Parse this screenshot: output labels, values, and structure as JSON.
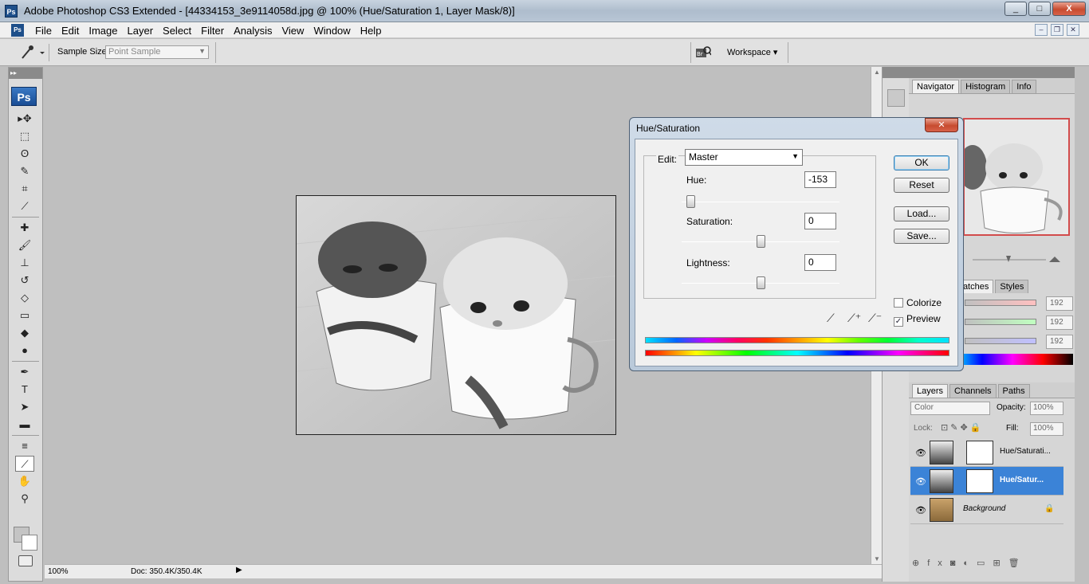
{
  "app": {
    "title": "Adobe Photoshop CS3 Extended - [44334153_3e9114058d.jpg @ 100% (Hue/Saturation 1, Layer Mask/8)]",
    "window_buttons": [
      "_",
      "□",
      "X"
    ]
  },
  "menu": {
    "items": [
      "File",
      "Edit",
      "Image",
      "Layer",
      "Select",
      "Filter",
      "Analysis",
      "View",
      "Window",
      "Help"
    ]
  },
  "options": {
    "sample_size_label": "Sample Size:",
    "sample_size_value": "Point Sample",
    "workspace_label": "Workspace ▾"
  },
  "toolbox": {
    "logo": "Ps",
    "tools": [
      {
        "name": "move-tool",
        "glyph": "▸✥"
      },
      {
        "name": "marquee-tool",
        "glyph": "⬚"
      },
      {
        "name": "lasso-tool",
        "glyph": "ʘ"
      },
      {
        "name": "quick-selection-tool",
        "glyph": "✎"
      },
      {
        "name": "crop-tool",
        "glyph": "⌗"
      },
      {
        "name": "slice-tool",
        "glyph": "⟋"
      },
      {
        "name": "healing-brush-tool",
        "glyph": "✚"
      },
      {
        "name": "brush-tool",
        "glyph": "🖌"
      },
      {
        "name": "clone-stamp-tool",
        "glyph": "⊥"
      },
      {
        "name": "history-brush-tool",
        "glyph": "↺"
      },
      {
        "name": "eraser-tool",
        "glyph": "◇"
      },
      {
        "name": "gradient-tool",
        "glyph": "▭"
      },
      {
        "name": "blur-tool",
        "glyph": "◆"
      },
      {
        "name": "dodge-tool",
        "glyph": "●"
      },
      {
        "name": "pen-tool",
        "glyph": "✒"
      },
      {
        "name": "type-tool",
        "glyph": "T"
      },
      {
        "name": "path-selection-tool",
        "glyph": "➤"
      },
      {
        "name": "rectangle-tool",
        "glyph": "▬"
      },
      {
        "name": "notes-tool",
        "glyph": "≡"
      },
      {
        "name": "eyedropper-tool",
        "glyph": "⟋"
      },
      {
        "name": "hand-tool",
        "glyph": "✋"
      },
      {
        "name": "zoom-tool",
        "glyph": "⚲"
      }
    ]
  },
  "status": {
    "zoom": "100%",
    "doc": "Doc: 350.4K/350.4K"
  },
  "navigator": {
    "tabs": [
      "Navigator",
      "Histogram",
      "Info"
    ]
  },
  "color": {
    "tabs": [
      "watches",
      "Styles"
    ],
    "values": [
      "192",
      "192",
      "192"
    ]
  },
  "layers": {
    "tabs": [
      "Layers",
      "Channels",
      "Paths"
    ],
    "blend_mode": "Color",
    "opacity_label": "Opacity:",
    "opacity_value": "100%",
    "lock_label": "Lock:",
    "fill_label": "Fill:",
    "fill_value": "100%",
    "rows": [
      {
        "name": "Hue/Saturati...",
        "selected": false
      },
      {
        "name": "Hue/Satur...",
        "selected": true
      },
      {
        "name": "Background",
        "selected": false
      }
    ]
  },
  "dialog": {
    "title": "Hue/Saturation",
    "edit_label": "Edit:",
    "edit_value": "Master",
    "hue_label": "Hue:",
    "hue_value": "-153",
    "saturation_label": "Saturation:",
    "saturation_value": "0",
    "lightness_label": "Lightness:",
    "lightness_value": "0",
    "ok": "OK",
    "reset": "Reset",
    "load": "Load...",
    "save": "Save...",
    "colorize": "Colorize",
    "preview": "Preview",
    "colorize_checked": false,
    "preview_checked": true
  }
}
